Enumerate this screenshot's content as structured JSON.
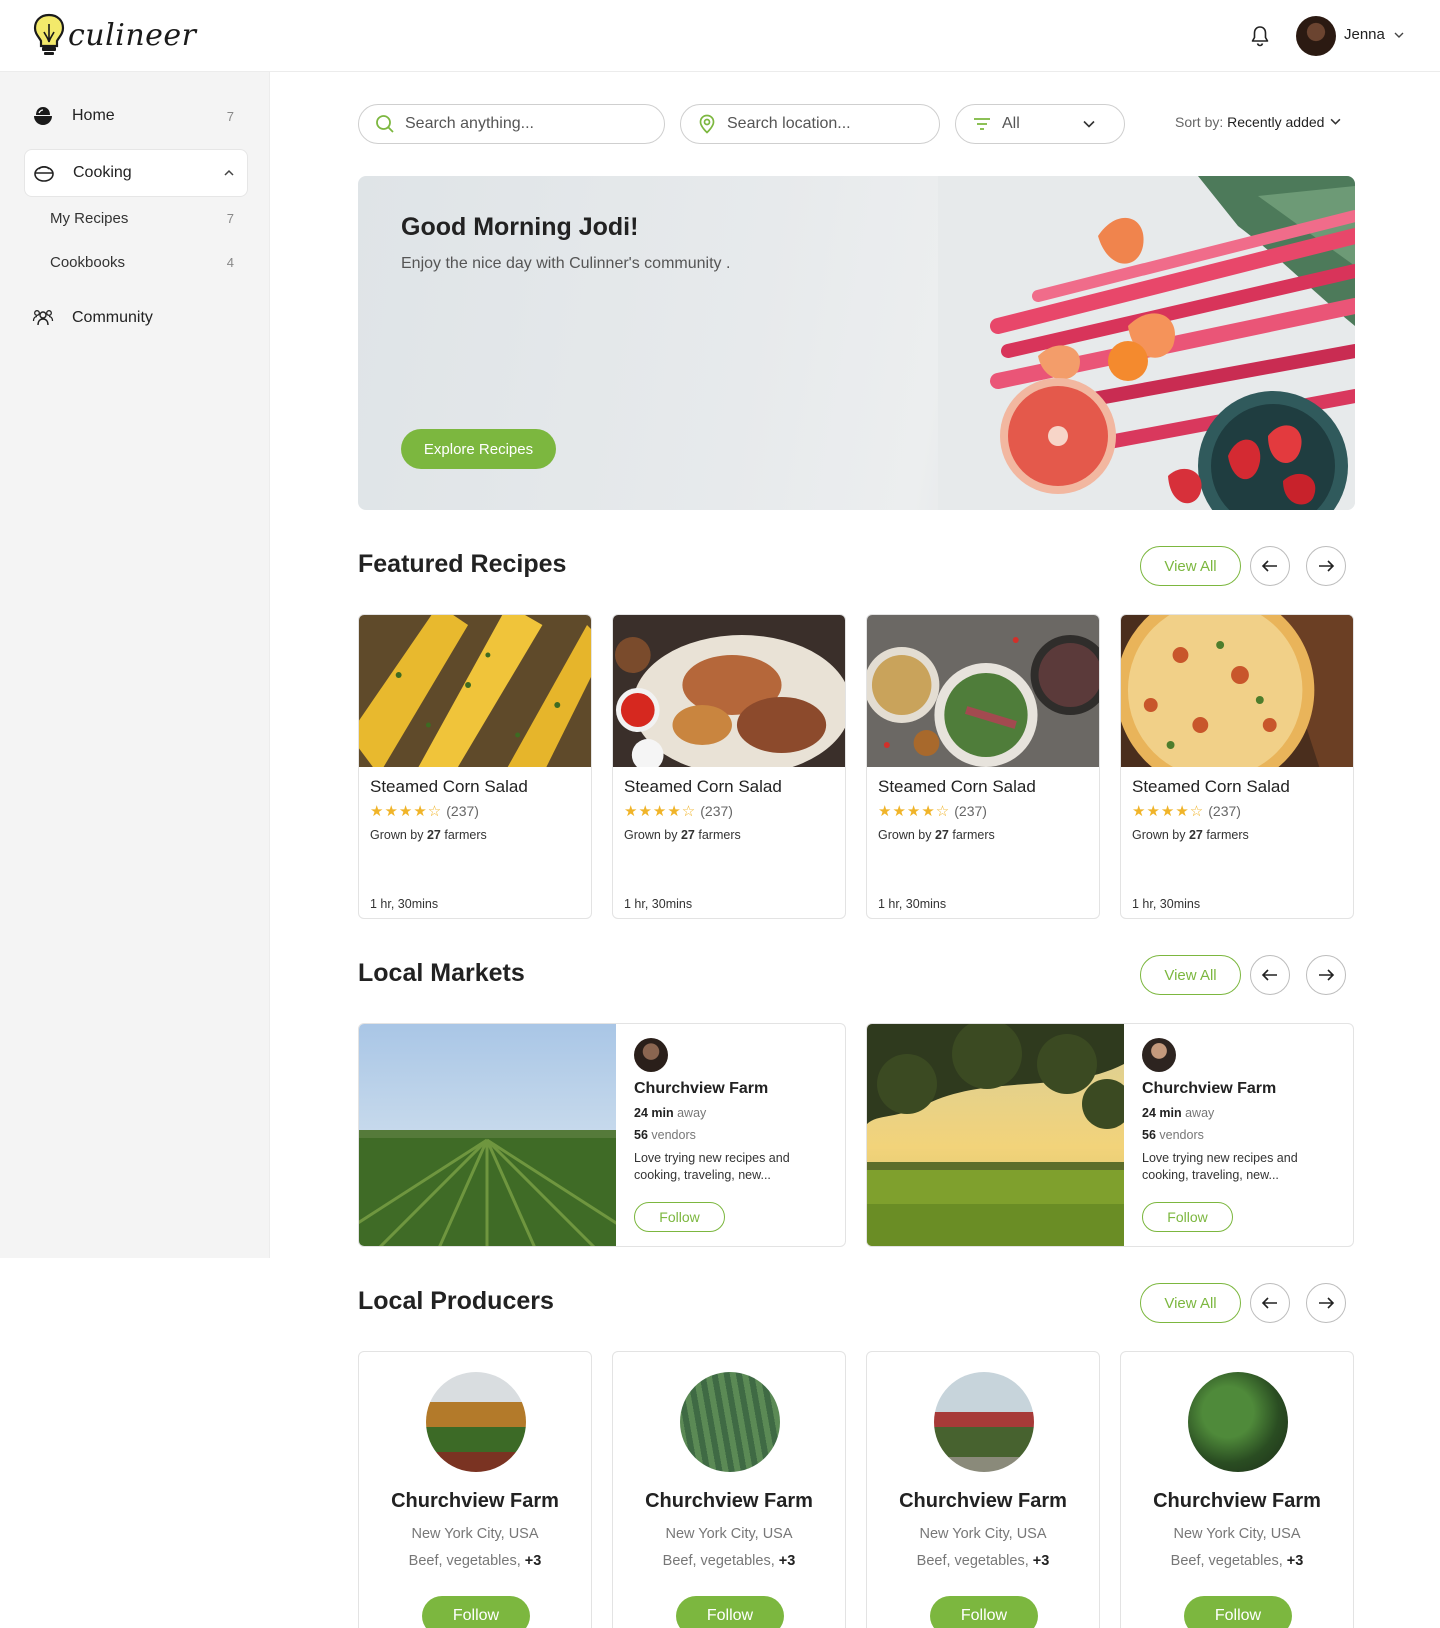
{
  "app": {
    "logo_text": "culineer"
  },
  "header": {
    "user_name": "Jenna"
  },
  "sidebar": {
    "items": [
      {
        "label": "Home",
        "count": "7",
        "icon": "bowl-icon"
      },
      {
        "label": "Cooking",
        "icon": "pot-icon",
        "expanded": true
      },
      {
        "label": "My Recipes",
        "count": "7"
      },
      {
        "label": "Cookbooks",
        "count": "4"
      },
      {
        "label": "Community",
        "icon": "people-icon"
      }
    ]
  },
  "filters": {
    "search_placeholder": "Search anything...",
    "location_placeholder": "Search location...",
    "category_value": "All",
    "sort_label": "Sort by:",
    "sort_value": "Recently added"
  },
  "hero": {
    "title": "Good Morning Jodi!",
    "subtitle": "Enjoy the nice day with Culinner's community .",
    "button": "Explore Recipes"
  },
  "sections": {
    "featured": "Featured Recipes",
    "markets": "Local Markets",
    "producers": "Local Producers",
    "view_all": "View All"
  },
  "recipes": [
    {
      "title": "Steamed Corn Salad",
      "rating": 4,
      "reviews": "(237)",
      "grown_pre": "Grown by",
      "farmers": "27",
      "grown_post": "farmers",
      "time": "1 hr, 30mins"
    },
    {
      "title": "Steamed Corn Salad",
      "rating": 4,
      "reviews": "(237)",
      "grown_pre": "Grown by",
      "farmers": "27",
      "grown_post": "farmers",
      "time": "1 hr, 30mins"
    },
    {
      "title": "Steamed Corn Salad",
      "rating": 4,
      "reviews": "(237)",
      "grown_pre": "Grown by",
      "farmers": "27",
      "grown_post": "farmers",
      "time": "1 hr, 30mins"
    },
    {
      "title": "Steamed Corn Salad",
      "rating": 4,
      "reviews": "(237)",
      "grown_pre": "Grown by",
      "farmers": "27",
      "grown_post": "farmers",
      "time": "1 hr, 30mins"
    }
  ],
  "markets": [
    {
      "name": "Churchview Farm",
      "minutes": "24 min",
      "away": "away",
      "vendors": "56",
      "vendors_label": "vendors",
      "description": "Love trying new recipes and cooking, traveling, new...",
      "follow": "Follow"
    },
    {
      "name": "Churchview Farm",
      "minutes": "24 min",
      "away": "away",
      "vendors": "56",
      "vendors_label": "vendors",
      "description": "Love trying new recipes and cooking, traveling, new...",
      "follow": "Follow"
    }
  ],
  "producers": [
    {
      "name": "Churchview Farm",
      "location": "New York City, USA",
      "items": "Beef, vegetables,",
      "more": "+3",
      "follow": "Follow"
    },
    {
      "name": "Churchview Farm",
      "location": "New York City, USA",
      "items": "Beef, vegetables,",
      "more": "+3",
      "follow": "Follow"
    },
    {
      "name": "Churchview Farm",
      "location": "New York City, USA",
      "items": "Beef, vegetables,",
      "more": "+3",
      "follow": "Follow"
    },
    {
      "name": "Churchview Farm",
      "location": "New York City, USA",
      "items": "Beef, vegetables,",
      "more": "+3",
      "follow": "Follow"
    }
  ],
  "colors": {
    "accent": "#7cb73f",
    "star": "#f0b429"
  }
}
